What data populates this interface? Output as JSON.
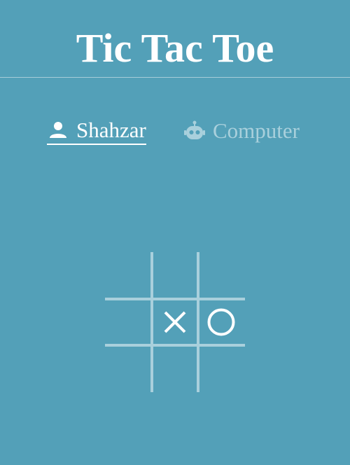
{
  "title": "Tic Tac Toe",
  "players": {
    "human": {
      "name": "Shahzar",
      "icon": "person-icon",
      "active": true
    },
    "computer": {
      "name": "Computer",
      "icon": "robot-icon",
      "active": false
    }
  },
  "board": [
    "",
    "",
    "",
    "",
    "X",
    "O",
    "",
    "",
    ""
  ],
  "colors": {
    "background": "#53a0b8",
    "active_text": "#ffffff",
    "inactive_text": "#a9d0dc",
    "grid": "#a9d0dc",
    "mark": "#ffffff"
  }
}
